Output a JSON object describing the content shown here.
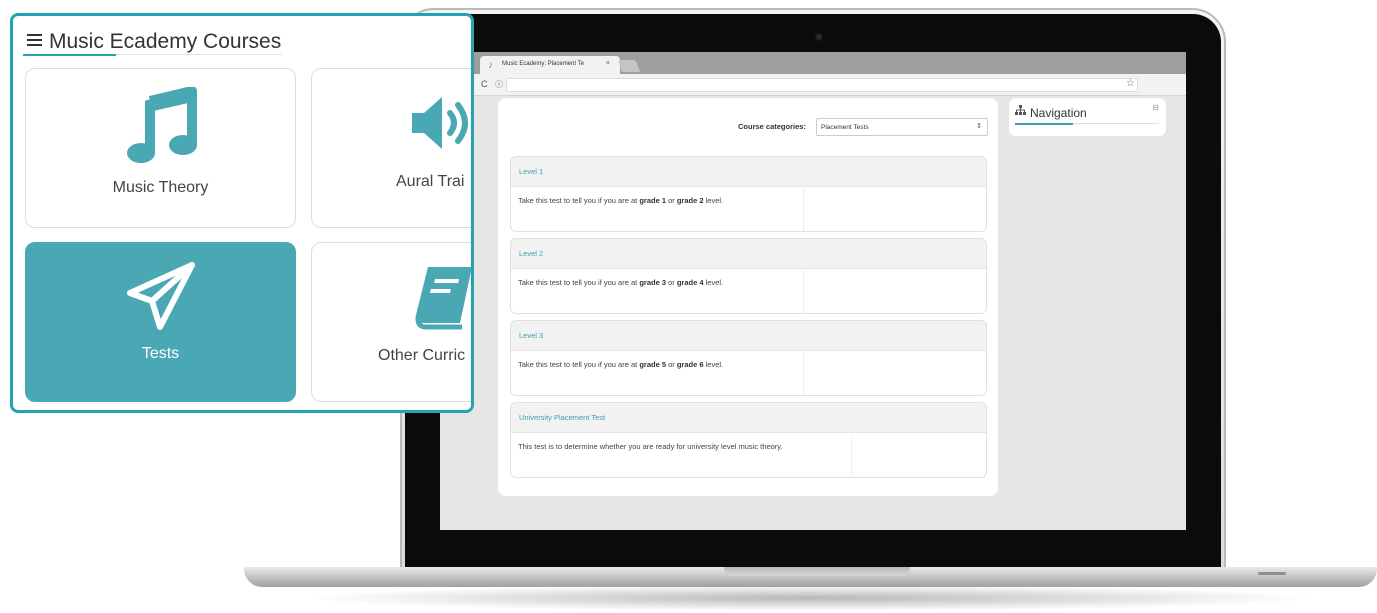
{
  "panel": {
    "title": "Music Ecademy Courses",
    "tiles": [
      {
        "label": "Music Theory",
        "icon": "music-note-icon",
        "selected": false
      },
      {
        "label": "Aural Trai",
        "icon": "speaker-icon",
        "selected": false
      },
      {
        "label": "Tests",
        "icon": "paper-plane-icon",
        "selected": true
      },
      {
        "label": "Other Curric",
        "icon": "book-icon",
        "selected": false
      }
    ],
    "accent": "#26a3b3",
    "selected_color": "#4aa8b5"
  },
  "browser": {
    "tab_title": "Music Ecademy: Placement Te",
    "tab_close": "×",
    "reload": "C",
    "info": "ⓘ",
    "star": "☆"
  },
  "page": {
    "category_label": "Course categories:",
    "category_value": "Placement Tests",
    "courses": [
      {
        "title": "Level 1",
        "pre": "Take this test to tell you if you are at ",
        "b1": "grade 1",
        "mid": " or ",
        "b2": "grade 2",
        "post": " level."
      },
      {
        "title": "Level 2",
        "pre": "Take this test to tell you if you are at ",
        "b1": "grade 3",
        "mid": " or ",
        "b2": "grade 4",
        "post": " level."
      },
      {
        "title": "Level 3",
        "pre": "Take this test to tell you if you are at ",
        "b1": "grade 5",
        "mid": " or ",
        "b2": "grade 6",
        "post": " level."
      },
      {
        "title": "University Placement Test",
        "text": "This test is to determine whether you are ready for university level music theory."
      }
    ],
    "navigation_title": "Navigation",
    "link_color": "#3d9db0"
  }
}
